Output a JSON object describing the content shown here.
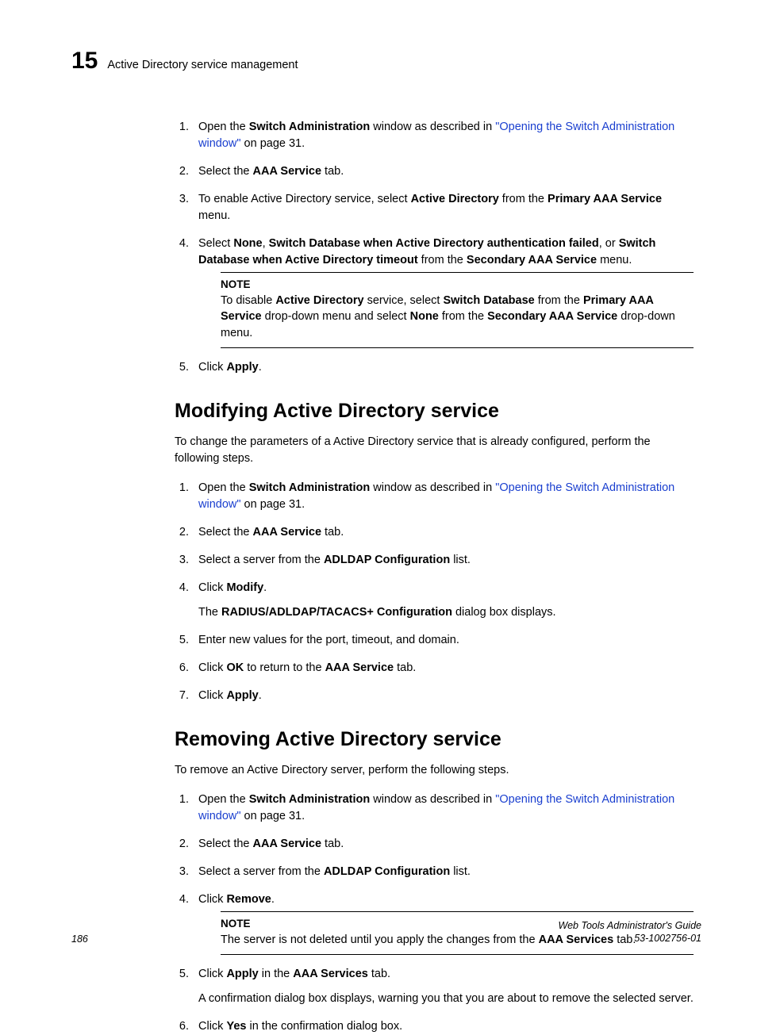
{
  "header": {
    "chapter": "15",
    "title": "Active Directory service management"
  },
  "sec1": {
    "s1a": "Open the ",
    "s1b": "Switch Administration",
    "s1c": " window as described in ",
    "s1link": "\"Opening the Switch Administration window\"",
    "s1d": " on page 31.",
    "s2a": "Select the ",
    "s2b": "AAA Service",
    "s2c": " tab.",
    "s3a": "To enable Active Directory service, select ",
    "s3b": "Active Directory",
    "s3c": " from the ",
    "s3d": "Primary AAA Service",
    "s3e": " menu.",
    "s4a": "Select ",
    "s4b": "None",
    "s4c": ", ",
    "s4d": "Switch Database when Active Directory authentication failed",
    "s4e": ", or ",
    "s4f": "Switch Database when Active Directory timeout",
    "s4g": " from the ",
    "s4h": "Secondary AAA Service",
    "s4i": " menu.",
    "note_label": "NOTE",
    "na": "To disable ",
    "nb": "Active Directory",
    "nc": " service, select ",
    "nd": "Switch Database",
    "ne": " from the ",
    "nf": "Primary AAA Service",
    "ng": " drop-down menu and select ",
    "nh": "None",
    "ni": " from the ",
    "nj": "Secondary AAA Service",
    "nk": " drop-down menu.",
    "s5a": "Click ",
    "s5b": "Apply",
    "s5c": "."
  },
  "sec2": {
    "heading": "Modifying Active Directory service",
    "intro": "To change the parameters of a Active Directory service that is already configured, perform the following steps.",
    "s1a": "Open the ",
    "s1b": "Switch Administration",
    "s1c": " window as described in ",
    "s1link": "\"Opening the Switch Administration window\"",
    "s1d": " on page 31.",
    "s2a": "Select the ",
    "s2b": "AAA Service",
    "s2c": " tab.",
    "s3a": "Select a server from the ",
    "s3b": "ADLDAP Configuration",
    "s3c": " list.",
    "s4a": "Click ",
    "s4b": "Modify",
    "s4c": ".",
    "s4sub_a": "The ",
    "s4sub_b": "RADIUS/ADLDAP/TACACS+ Configuration",
    "s4sub_c": " dialog box displays.",
    "s5": "Enter new values for the port, timeout, and domain.",
    "s6a": "Click ",
    "s6b": "OK",
    "s6c": " to return to the ",
    "s6d": "AAA Service",
    "s6e": " tab.",
    "s7a": "Click ",
    "s7b": "Apply",
    "s7c": "."
  },
  "sec3": {
    "heading": "Removing Active Directory service",
    "intro": "To remove an Active Directory server, perform the following steps.",
    "s1a": "Open the ",
    "s1b": "Switch Administration",
    "s1c": " window as described in ",
    "s1link": "\"Opening the Switch Administration window\"",
    "s1d": " on page 31.",
    "s2a": "Select the ",
    "s2b": "AAA Service",
    "s2c": " tab.",
    "s3a": "Select a server from the ",
    "s3b": "ADLDAP Configuration",
    "s3c": " list.",
    "s4a": "Click ",
    "s4b": "Remove",
    "s4c": ".",
    "note_label": "NOTE",
    "na": "The server is not deleted until you apply the changes from the ",
    "nb": "AAA Services",
    "nc": " tab.",
    "s5a": "Click ",
    "s5b": "Apply",
    "s5c": " in the ",
    "s5d": "AAA Services",
    "s5e": " tab.",
    "s5sub": "A confirmation dialog box displays, warning you that you are about to remove the selected server.",
    "s6a": "Click ",
    "s6b": "Yes",
    "s6c": " in the confirmation dialog box."
  },
  "footer": {
    "page": "186",
    "guide": "Web Tools Administrator's Guide",
    "docnum": "53-1002756-01"
  }
}
